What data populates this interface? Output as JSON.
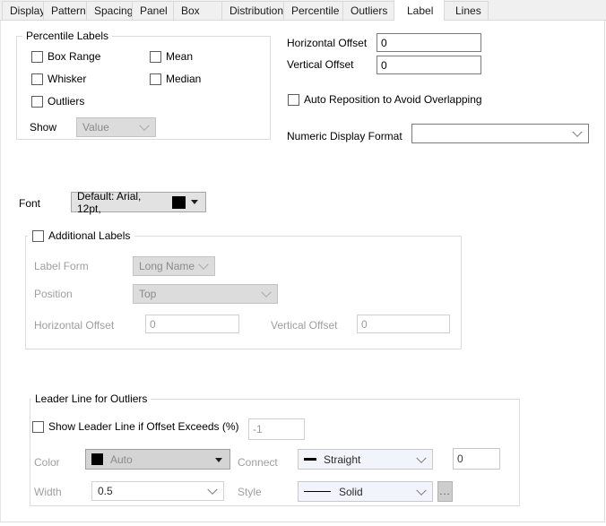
{
  "tabs": [
    {
      "label": "Display"
    },
    {
      "label": "Pattern"
    },
    {
      "label": "Spacing"
    },
    {
      "label": "Panel"
    },
    {
      "label": "Box"
    },
    {
      "label": "Distribution"
    },
    {
      "label": "Percentile"
    },
    {
      "label": "Outliers"
    },
    {
      "label": "Label",
      "selected": true
    },
    {
      "label": "Lines"
    }
  ],
  "percentile_labels": {
    "title": "Percentile Labels",
    "box_range": "Box Range",
    "mean": "Mean",
    "whisker": "Whisker",
    "median": "Median",
    "outliers": "Outliers",
    "show_label": "Show",
    "show_value": "Value"
  },
  "top_right": {
    "horizontal_offset_label": "Horizontal Offset",
    "horizontal_offset_value": "0",
    "vertical_offset_label": "Vertical Offset",
    "vertical_offset_value": "0",
    "auto_reposition_label": "Auto Reposition to Avoid Overlapping",
    "numeric_display_format_label": "Numeric Display Format",
    "numeric_display_format_value": ""
  },
  "font_row": {
    "label": "Font",
    "value": "Default: Arial, 12pt,",
    "swatch_color": "#000000"
  },
  "additional_labels": {
    "title": "Additional Labels",
    "label_form_label": "Label Form",
    "label_form_value": "Long Name",
    "position_label": "Position",
    "position_value": "Top",
    "horizontal_offset_label": "Horizontal Offset",
    "horizontal_offset_value": "0",
    "vertical_offset_label": "Vertical Offset",
    "vertical_offset_value": "0"
  },
  "leader_line": {
    "title": "Leader Line for Outliers",
    "show_label": "Show Leader Line if Offset Exceeds (%)",
    "threshold_value": "-1",
    "color_label": "Color",
    "color_value": "Auto",
    "color_swatch": "#000000",
    "connect_label": "Connect",
    "connect_value": "Straight",
    "connect_offset_value": "0",
    "width_label": "Width",
    "width_value": "0.5",
    "style_label": "Style",
    "style_value": "Solid",
    "more_button": "..."
  }
}
